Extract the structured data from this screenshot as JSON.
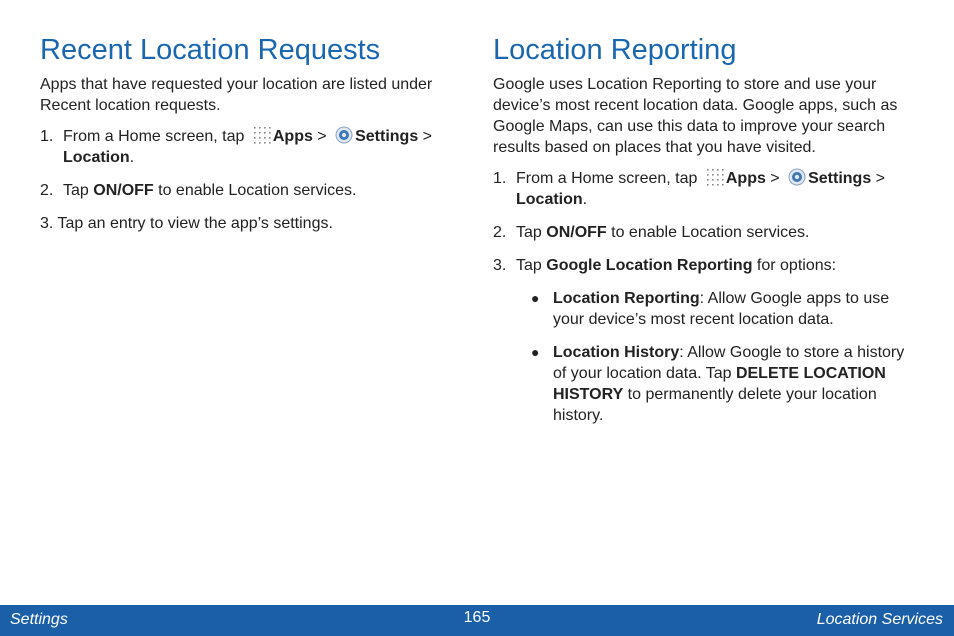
{
  "left": {
    "title": "Recent Location Requests",
    "intro": "Apps that have requested your location are listed under Recent location requests.",
    "steps": [
      {
        "num": "1.",
        "pre": "From a Home screen, tap",
        "apps": "Apps",
        "sep1": " > ",
        "settings": "Settings",
        "sep2": " > ",
        "location": "Location",
        "end": "."
      },
      {
        "num": "2.",
        "pre": "Tap ",
        "bold": "ON/OFF",
        "post": " to enable Location services."
      },
      {
        "num": "3.",
        "text": "Tap an entry to view the app’s settings."
      }
    ]
  },
  "right": {
    "title": "Location Reporting",
    "intro": "Google uses Location Reporting to store and use your device’s most recent location data. Google apps, such as Google Maps, can use this data to improve your search results based on places that you have visited.",
    "steps": [
      {
        "num": "1.",
        "pre": "From a Home screen, tap",
        "apps": "Apps",
        "sep1": " > ",
        "settings": "Settings",
        "sep2": " > ",
        "location": "Location",
        "end": "."
      },
      {
        "num": "2.",
        "pre": "Tap ",
        "bold": "ON/OFF",
        "post": " to enable Location services."
      },
      {
        "num": "3.",
        "pre": "Tap ",
        "bold": "Google Location Reporting",
        "post": " for options:"
      }
    ],
    "bullets": [
      {
        "bold": "Location Reporting",
        "text": ": Allow Google apps to use your device’s most recent location data."
      },
      {
        "bold": "Location History",
        "text": ": Allow Google to store a history of your location data. Tap ",
        "bold2": "DELETE LOCATION HISTORY",
        "text2": " to permanently delete your location history."
      }
    ]
  },
  "footer": {
    "left": "Settings",
    "page": "165",
    "right": "Location Services"
  },
  "colors": {
    "heading": "#1a67b0",
    "footer_bg": "#1a5fa8"
  },
  "icons": {
    "apps": "apps-grid-icon",
    "settings": "settings-gear-icon"
  }
}
